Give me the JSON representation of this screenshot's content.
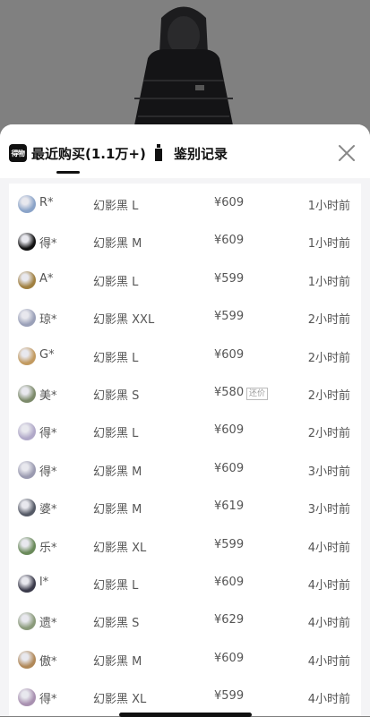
{
  "tabs": {
    "recent_logo": "得物",
    "recent_label": "最近购买(1.1万+)",
    "auth_label": "鉴别记录"
  },
  "colors": {
    "sheet_bg": "#f4f4f6",
    "text": "#555555",
    "title": "#111111"
  },
  "icons": [
    "dewu-logo-icon",
    "bottle-icon",
    "close-icon"
  ],
  "purchases": [
    {
      "name": "R*",
      "spec": "幻影黑 L",
      "price": "¥609",
      "tag": "",
      "time": "1小时前",
      "avatar": "#8aa3c8"
    },
    {
      "name": "得*",
      "spec": "幻影黑 M",
      "price": "¥609",
      "tag": "",
      "time": "1小时前",
      "avatar": "#111111"
    },
    {
      "name": "A*",
      "spec": "幻影黑 L",
      "price": "¥599",
      "tag": "",
      "time": "1小时前",
      "avatar": "#a08040"
    },
    {
      "name": "琼*",
      "spec": "幻影黑 XXL",
      "price": "¥599",
      "tag": "",
      "time": "2小时前",
      "avatar": "#9aa0b8"
    },
    {
      "name": "G*",
      "spec": "幻影黑 L",
      "price": "¥609",
      "tag": "",
      "time": "2小时前",
      "avatar": "#c29a60"
    },
    {
      "name": "美*",
      "spec": "幻影黑 S",
      "price": "¥580",
      "tag": "还价",
      "time": "2小时前",
      "avatar": "#7c8a6a"
    },
    {
      "name": "得*",
      "spec": "幻影黑 L",
      "price": "¥609",
      "tag": "",
      "time": "2小时前",
      "avatar": "#b0a8c8"
    },
    {
      "name": "得*",
      "spec": "幻影黑 M",
      "price": "¥609",
      "tag": "",
      "time": "3小时前",
      "avatar": "#9a9ab0"
    },
    {
      "name": "婆*",
      "spec": "幻影黑 M",
      "price": "¥619",
      "tag": "",
      "time": "3小时前",
      "avatar": "#555a66"
    },
    {
      "name": "乐*",
      "spec": "幻影黑 XL",
      "price": "¥599",
      "tag": "",
      "time": "4小时前",
      "avatar": "#6a8a5a"
    },
    {
      "name": "l*",
      "spec": "幻影黑 L",
      "price": "¥609",
      "tag": "",
      "time": "4小时前",
      "avatar": "#3a3a4a"
    },
    {
      "name": "遗*",
      "spec": "幻影黑 S",
      "price": "¥629",
      "tag": "",
      "time": "4小时前",
      "avatar": "#8a9a7a"
    },
    {
      "name": "傲*",
      "spec": "幻影黑 M",
      "price": "¥609",
      "tag": "",
      "time": "4小时前",
      "avatar": "#b08858"
    },
    {
      "name": "得*",
      "spec": "幻影黑 XL",
      "price": "¥599",
      "tag": "",
      "time": "4小时前",
      "avatar": "#a890b0"
    }
  ]
}
